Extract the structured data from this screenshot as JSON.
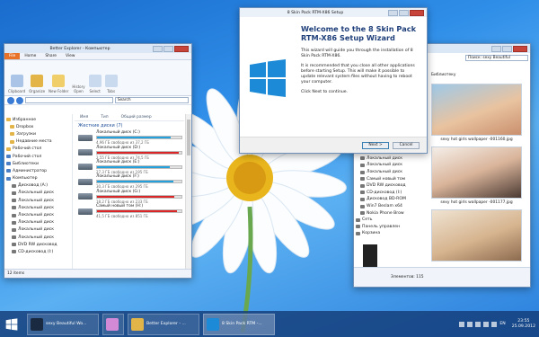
{
  "explorer": {
    "title": "Better Explorer - Компьютер",
    "tabs": [
      "File",
      "Home",
      "Share",
      "View"
    ],
    "ribbon": {
      "history_label": "History",
      "open_label": "Open",
      "select_label": "Select",
      "tabs_label": "Tabs",
      "new_folder_label": "New Folder",
      "groups": [
        "Clipboard",
        "Organize",
        "New",
        "Open"
      ]
    },
    "search_placeholder": "Search",
    "columns": [
      "Имя",
      "Тип",
      "Общий размер"
    ],
    "group_header": "Жесткие диски (7)",
    "tree": [
      "Избранное",
      "Dropbox",
      "Загрузки",
      "Недавние места",
      "Рабочий стол",
      "Рабочий стол",
      "Библиотеки",
      "Администратор",
      "Компьютер",
      "Дисковод (A:)",
      "Локальный диск",
      "Локальный диск",
      "Локальный диск",
      "Локальный диск",
      "Локальный диск",
      "Локальный диск",
      "Локальный диск",
      "DVD RW дисковод",
      "CD-дисковод (I:)"
    ],
    "drives": [
      {
        "name": "Локальный диск (C:)",
        "free": "4,96 ГБ свободно из 37,2 ГБ",
        "used": 0.87,
        "color": "blue"
      },
      {
        "name": "Локальный диск (D:)",
        "free": "2,55 ГБ свободно из 74,5 ГБ",
        "used": 0.97,
        "color": "red"
      },
      {
        "name": "Локальный диск (E:)",
        "free": "27,3 ГБ свободно из 195 ГБ",
        "used": 0.86,
        "color": "blue"
      },
      {
        "name": "Локальный диск (F:)",
        "free": "30,3 ГБ свободно из 295 ГБ",
        "used": 0.9,
        "color": "blue"
      },
      {
        "name": "Локальный диск (G:)",
        "free": "18,2 ГБ свободно из 233 ГБ",
        "used": 0.92,
        "color": "red"
      },
      {
        "name": "Самый новый том (H:)",
        "free": "41,5 ГБ свободно из 851 ГБ",
        "used": 0.95,
        "color": "red"
      }
    ],
    "status": "12 items"
  },
  "setup": {
    "title": "8 Skin Pack RTM-X86 Setup",
    "heading": "Welcome to the 8 Skin Pack RTM-X86 Setup Wizard",
    "p1": "This wizard will guide you through the installation of 8 Skin Pack RTM-X86.",
    "p2": "It is recommended that you close all other applications before starting Setup. This will make it possible to update relevant system files without having to reboot your computer.",
    "p3": "Click Next to continue.",
    "next_label": "Next >",
    "cancel_label": "Cancel"
  },
  "viewer": {
    "search_placeholder": "Поиск: sexy Beautiful",
    "menu_label": "Справка",
    "lib_label": "Библиотеку",
    "images": [
      {
        "caption": "sexy hot girls wallpaper -001160.jpg"
      },
      {
        "caption": "sexy hot girls wallpaper -001177.jpg"
      },
      {
        "caption": ""
      }
    ],
    "tree": [
      "Рабочий стол",
      "Компьютер",
      "Дисковод (A:)",
      "Локальный диск",
      "Локальный диск",
      "Локальный диск",
      "Локальный диск",
      "Локальный диск",
      "Локальный диск",
      "Самый новый том",
      "DVD RW дисковод",
      "CD-дисковод (I:)",
      "Дисковод BD-ROM",
      "Win7 Beslam x64",
      "Nokia Phone Brow",
      "Сеть",
      "Панель управлен",
      "Корзина"
    ],
    "status": "Элементов: 115"
  },
  "taskbar": {
    "items": [
      "sexy Beautiful Wo...",
      "",
      "Better Explorer - ...",
      "8 Skin Pack RTM -..."
    ],
    "lang": "EN",
    "time": "23:55",
    "date": "25.09.2012"
  }
}
